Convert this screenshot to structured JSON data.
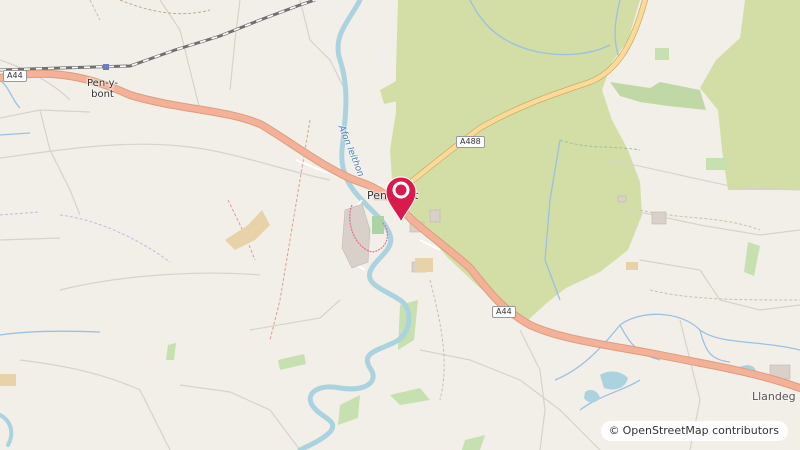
{
  "map": {
    "places": {
      "pen_y_bont_line1": "Pen-y-",
      "pen_y_bont_line2": "bont",
      "penybont_village": "Penybont",
      "llandegley": "Llandeg"
    },
    "roads": {
      "a44_west": "A44",
      "a488": "A488",
      "a44_east": "A44"
    },
    "river": "Afon Ieithon",
    "marker_icon": "location-pin-icon",
    "marker_color": "#d81b4a"
  },
  "attribution": {
    "copyright_symbol": "©",
    "text": "OpenStreetMap contributors"
  }
}
